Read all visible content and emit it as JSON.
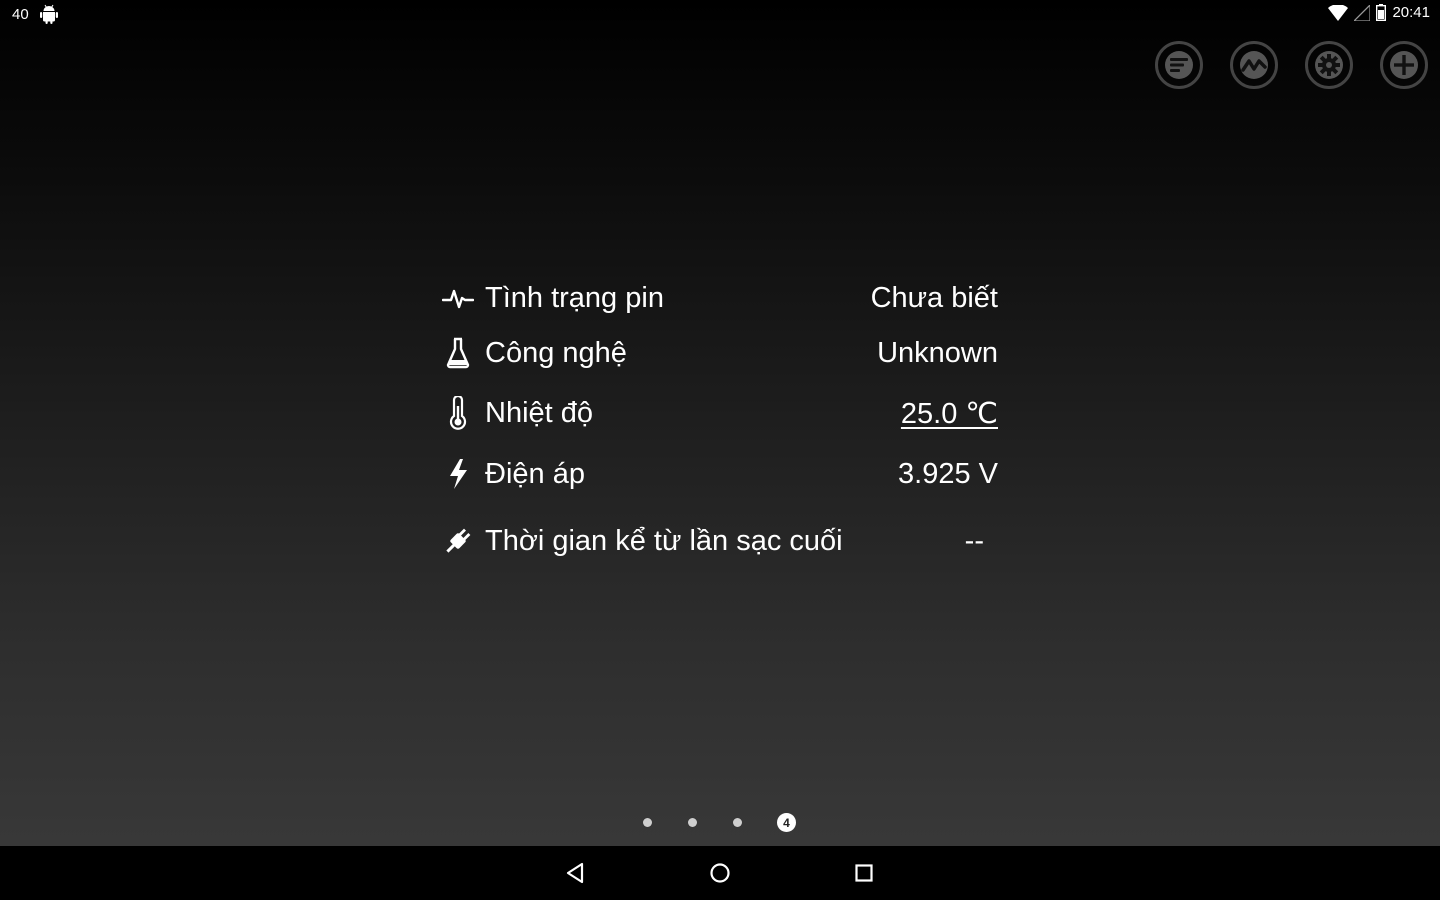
{
  "status_bar": {
    "notification_count": "40",
    "time": "20:41"
  },
  "toolbar": {
    "buttons": [
      {
        "icon": "list-icon"
      },
      {
        "icon": "graph-icon"
      },
      {
        "icon": "gear-icon"
      },
      {
        "icon": "plus-icon"
      }
    ]
  },
  "battery_info": {
    "rows": [
      {
        "icon": "heartbeat-icon",
        "label": "Tình trạng pin",
        "value": "Chưa biết"
      },
      {
        "icon": "flask-icon",
        "label": "Công nghệ",
        "value": "Unknown"
      },
      {
        "icon": "thermometer-icon",
        "label": "Nhiệt độ",
        "value": "25.0 ℃"
      },
      {
        "icon": "lightning-icon",
        "label": "Điện áp",
        "value": "3.925 V"
      },
      {
        "icon": "plug-icon",
        "label": "Thời gian kể từ lần sạc cuối",
        "value": "--"
      }
    ]
  },
  "pager": {
    "page_count": 4,
    "current_page": "4"
  },
  "colors": {
    "background_top": "#000000",
    "background_bottom": "#383838",
    "icon_ring": "#444444",
    "text": "#ffffff"
  }
}
